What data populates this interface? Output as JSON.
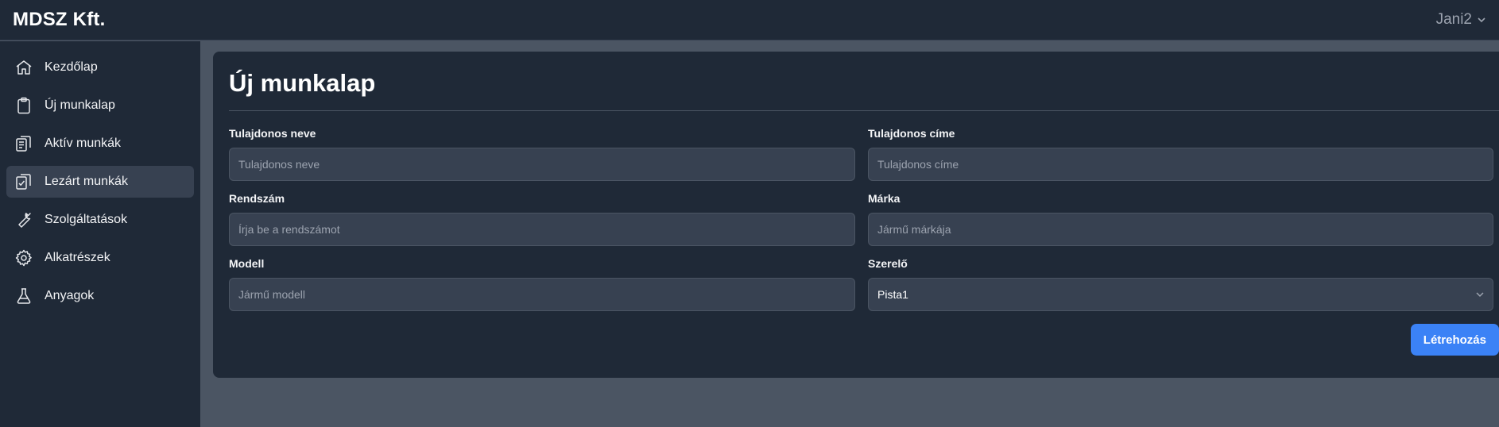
{
  "header": {
    "brand": "MDSZ Kft.",
    "user": "Jani2"
  },
  "sidebar": {
    "items": [
      {
        "label": "Kezdőlap",
        "icon": "home-icon"
      },
      {
        "label": "Új munkalap",
        "icon": "clipboard-icon"
      },
      {
        "label": "Aktív munkák",
        "icon": "clipboard-list-icon"
      },
      {
        "label": "Lezárt munkák",
        "icon": "clipboard-check-icon",
        "active": true
      },
      {
        "label": "Szolgáltatások",
        "icon": "wrench-icon"
      },
      {
        "label": "Alkatrészek",
        "icon": "gear-icon"
      },
      {
        "label": "Anyagok",
        "icon": "flask-icon"
      }
    ]
  },
  "form": {
    "title": "Új munkalap",
    "owner_name": {
      "label": "Tulajdonos neve",
      "placeholder": "Tulajdonos neve",
      "value": ""
    },
    "owner_address": {
      "label": "Tulajdonos címe",
      "placeholder": "Tulajdonos címe",
      "value": ""
    },
    "plate": {
      "label": "Rendszám",
      "placeholder": "Írja be a rendszámot",
      "value": ""
    },
    "brand": {
      "label": "Márka",
      "placeholder": "Jármű márkája",
      "value": ""
    },
    "model": {
      "label": "Modell",
      "placeholder": "Jármű modell",
      "value": ""
    },
    "mechanic": {
      "label": "Szerelő",
      "value": "Pista1"
    },
    "submit_label": "Létrehozás"
  },
  "colors": {
    "accent": "#3b82f6",
    "panel": "#1f2937",
    "background": "#4b5563",
    "input": "#374151"
  }
}
